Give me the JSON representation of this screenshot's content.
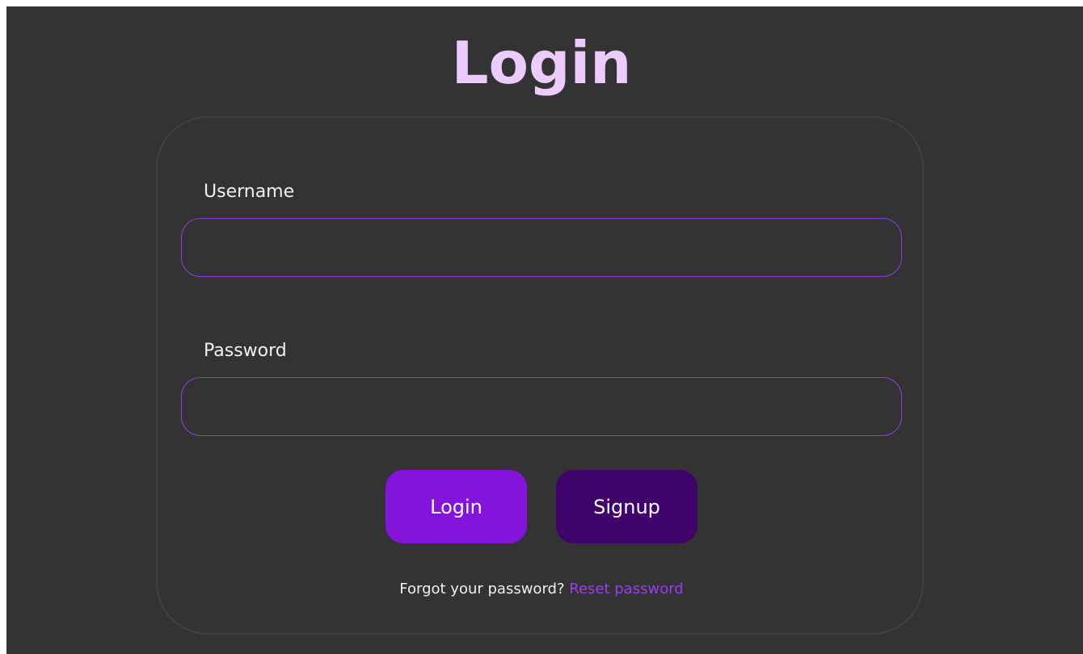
{
  "page": {
    "title": "Login"
  },
  "form": {
    "username": {
      "label": "Username",
      "value": "",
      "placeholder": ""
    },
    "password": {
      "label": "Password",
      "value": "",
      "placeholder": ""
    },
    "login_label": "Login",
    "signup_label": "Signup"
  },
  "footer": {
    "prompt": "Forgot your password?",
    "link_label": "Reset password"
  },
  "colors": {
    "background": "#333333",
    "title": "#ecccfc",
    "input_border": "#8f3fe0",
    "login_button": "#8413dc",
    "signup_button": "#40036c",
    "link": "#9b3cf0"
  }
}
